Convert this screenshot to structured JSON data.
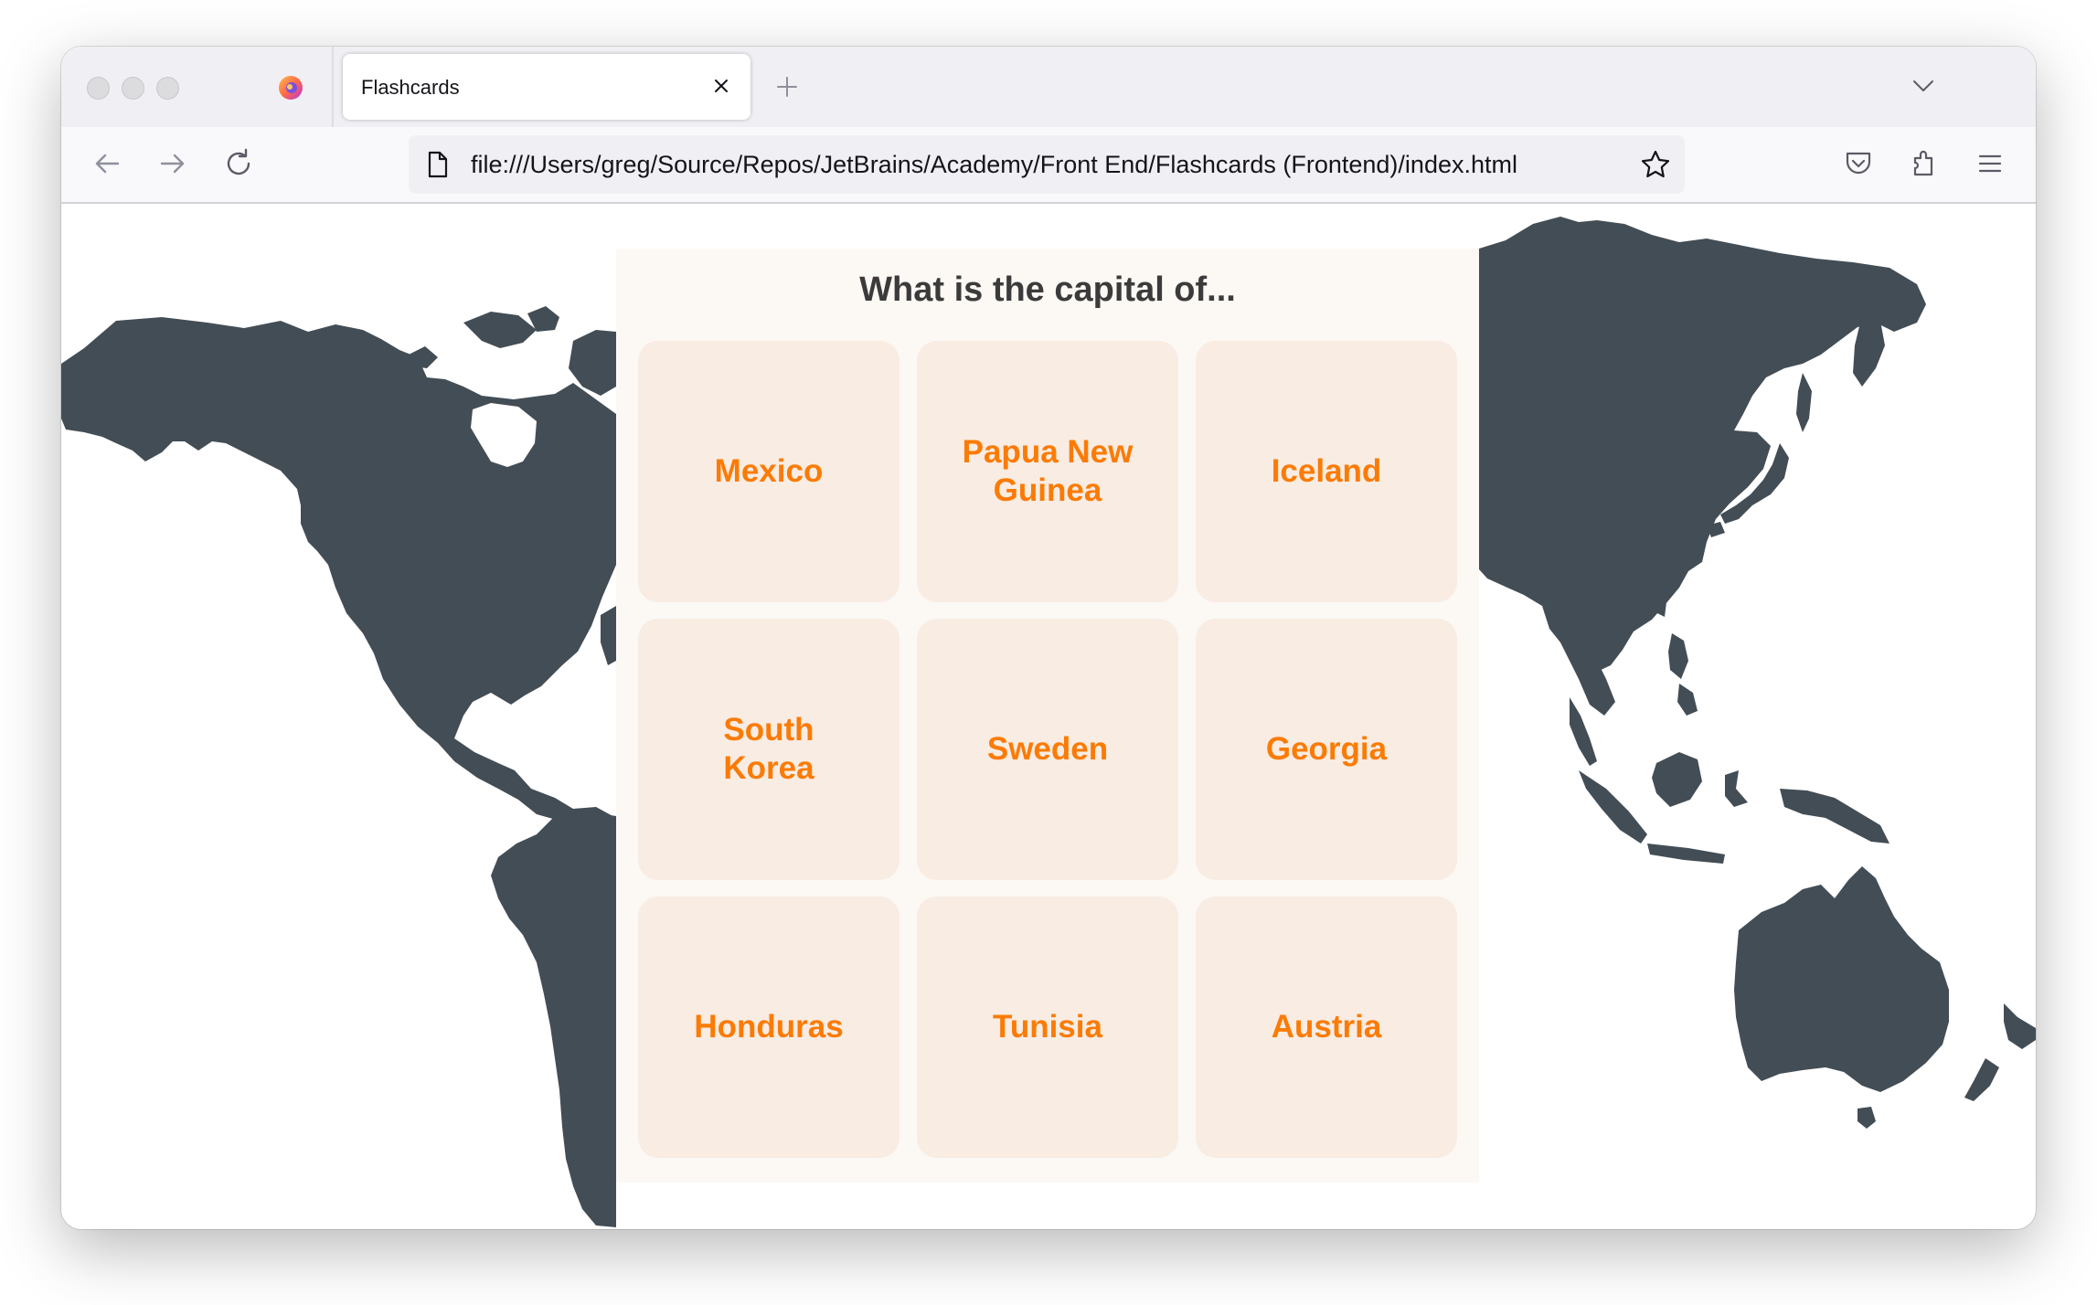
{
  "browser": {
    "tab_title": "Flashcards",
    "url": "file:///Users/greg/Source/Repos/JetBrains/Academy/Front End/Flashcards (Frontend)/index.html"
  },
  "page": {
    "title": "What is the capital of...",
    "cards": [
      {
        "label": "Mexico"
      },
      {
        "label": "Papua New Guinea"
      },
      {
        "label": "Iceland"
      },
      {
        "label": "South Korea"
      },
      {
        "label": "Sweden"
      },
      {
        "label": "Georgia"
      },
      {
        "label": "Honduras"
      },
      {
        "label": "Tunisia"
      },
      {
        "label": "Austria"
      }
    ]
  },
  "colors": {
    "map": "#434d55",
    "card_background": "#f8ece3",
    "card_text": "#fb7b05",
    "panel_background": "#fcf8f4",
    "title_text": "#3b3b3b"
  }
}
